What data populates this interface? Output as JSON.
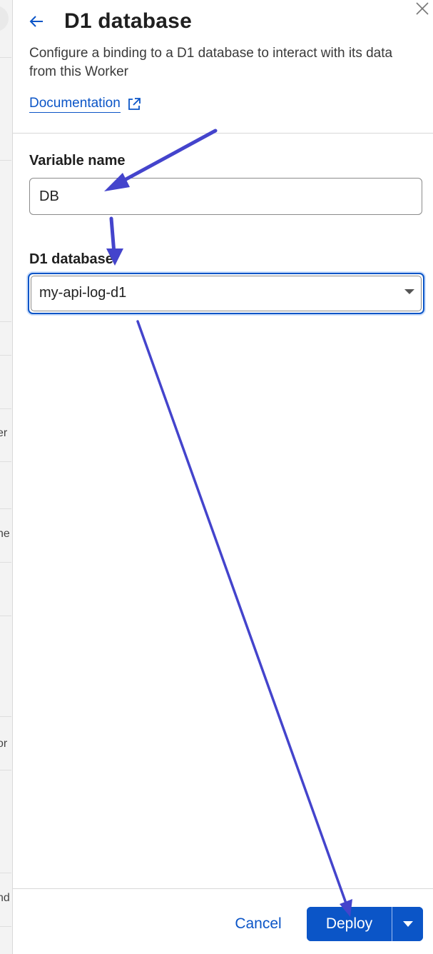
{
  "background_fragments": [
    "er",
    "ne",
    "or",
    "nd"
  ],
  "panel": {
    "title": "D1 database",
    "description": "Configure a binding to a D1 database to interact with its data from this Worker",
    "documentation_link": "Documentation"
  },
  "form": {
    "variable_name_label": "Variable name",
    "variable_name_value": "DB",
    "d1_database_label": "D1 database",
    "d1_database_value": "my-api-log-d1"
  },
  "footer": {
    "cancel_label": "Cancel",
    "deploy_label": "Deploy"
  },
  "colors": {
    "accent": "#0b55c7",
    "annotation_arrow": "#4444cc"
  },
  "icons": {
    "close": "close-icon",
    "back": "arrow-left-icon",
    "external_link": "external-link-icon",
    "select_caret": "caret-down-icon",
    "menu_caret": "caret-down-icon"
  }
}
